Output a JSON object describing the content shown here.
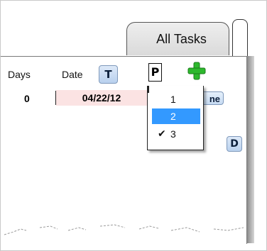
{
  "tab": {
    "label": "All Tasks"
  },
  "columns": {
    "days": "Days",
    "date": "Date"
  },
  "toolbar": {
    "t_label": "T",
    "p_label": "P",
    "add_icon": "plus-icon",
    "add_color": "#2db82d"
  },
  "row": {
    "days": "0",
    "date": "04/22/12",
    "none_label": "ne"
  },
  "priority_menu": {
    "items": [
      {
        "label": "1",
        "selected": false,
        "checked": false
      },
      {
        "label": "2",
        "selected": true,
        "checked": false
      },
      {
        "label": "3",
        "selected": false,
        "checked": true
      }
    ],
    "check_glyph": "✔"
  },
  "side": {
    "d_label": "D"
  },
  "colors": {
    "date_bg": "#fbe3e3",
    "highlight": "#3399ff",
    "button_blue": "#c5daf2"
  }
}
